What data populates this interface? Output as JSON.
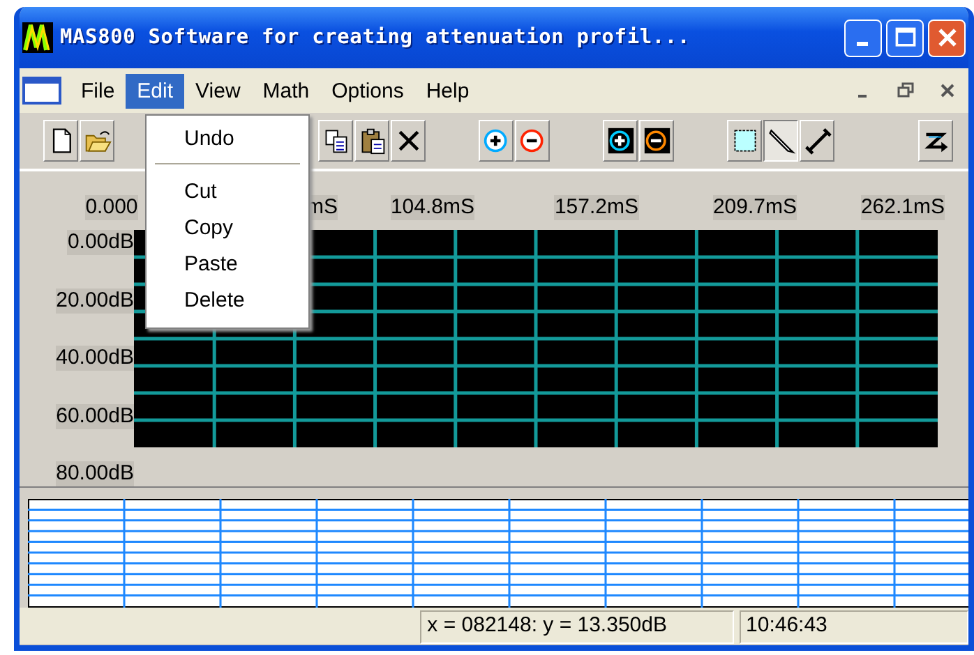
{
  "window": {
    "title": "MAS800 Software for creating attenuation profil..."
  },
  "menu_bar": [
    {
      "label": "File",
      "selected": false
    },
    {
      "label": "Edit",
      "selected": true
    },
    {
      "label": "View",
      "selected": false
    },
    {
      "label": "Math",
      "selected": false
    },
    {
      "label": "Options",
      "selected": false
    },
    {
      "label": "Help",
      "selected": false
    }
  ],
  "edit_menu": [
    {
      "kind": "item",
      "label": "Undo"
    },
    {
      "kind": "separator"
    },
    {
      "kind": "item",
      "label": "Cut"
    },
    {
      "kind": "item",
      "label": "Copy"
    },
    {
      "kind": "item",
      "label": "Paste"
    },
    {
      "kind": "item",
      "label": "Delete"
    }
  ],
  "toolbar": [
    [
      {
        "kind": "new",
        "pressed": false
      },
      {
        "kind": "open",
        "pressed": false
      }
    ],
    [
      {
        "kind": "copy",
        "pressed": false
      },
      {
        "kind": "paste",
        "pressed": false
      },
      {
        "kind": "delete",
        "pressed": false
      }
    ],
    [
      {
        "kind": "zoom-in-h",
        "pressed": false
      },
      {
        "kind": "zoom-out-h",
        "pressed": false
      }
    ],
    [
      {
        "kind": "zoom-in-x",
        "pressed": false
      },
      {
        "kind": "zoom-out-x",
        "pressed": false
      }
    ],
    [
      {
        "kind": "select",
        "pressed": false
      },
      {
        "kind": "pencil",
        "pressed": true
      },
      {
        "kind": "line",
        "pressed": false
      }
    ],
    [
      {
        "kind": "arrow",
        "pressed": false
      }
    ]
  ],
  "graph": {
    "time_labels": [
      "0.000",
      "mS",
      "104.8mS",
      "157.2mS",
      "209.7mS",
      "262.1mS"
    ],
    "db_labels": [
      "0.00dB",
      "20.00dB",
      "40.00dB",
      "60.00dB",
      "80.00dB"
    ]
  },
  "status_bar": {
    "position": "x = 082148: y = 13.350dB",
    "time": "10:46:43"
  }
}
